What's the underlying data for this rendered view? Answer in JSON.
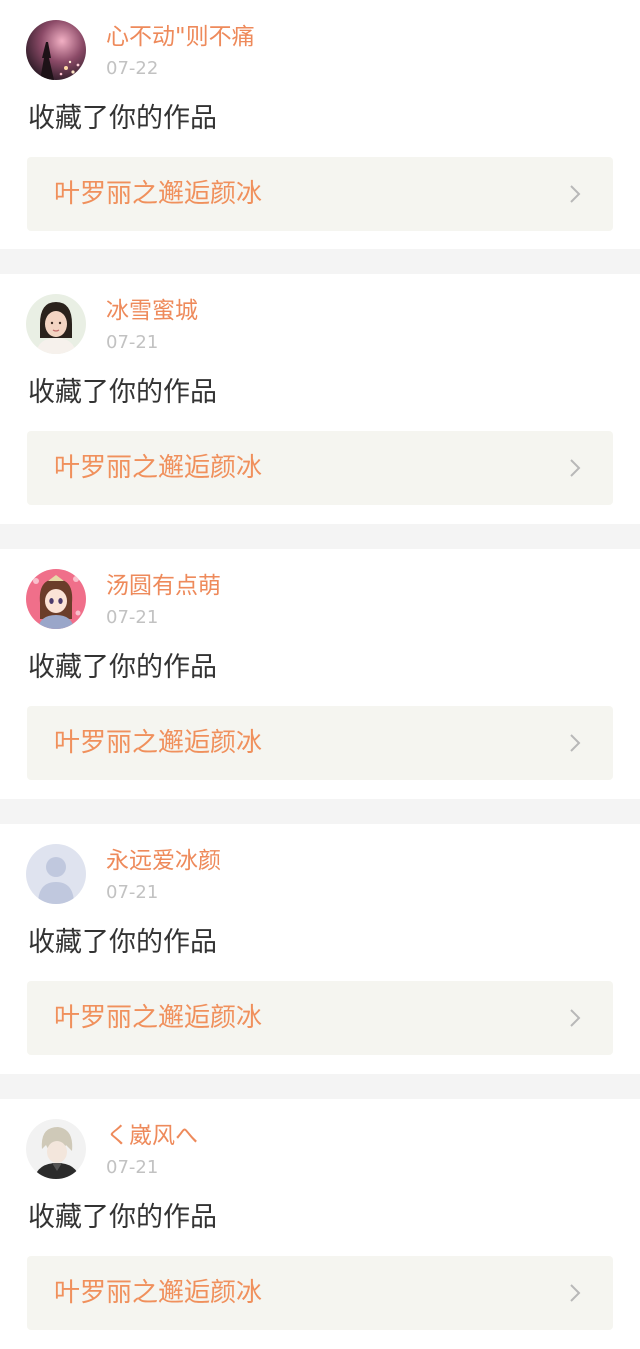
{
  "notifications": [
    {
      "username": "心不动\"则不痛",
      "date": "07-22",
      "action": "收藏了你的作品",
      "work_title": "叶罗丽之邂逅颜冰",
      "avatar_icon": "eiffel-tower-night-avatar"
    },
    {
      "username": "冰雪蜜城",
      "date": "07-21",
      "action": "收藏了你的作品",
      "work_title": "叶罗丽之邂逅颜冰",
      "avatar_icon": "woman-portrait-avatar"
    },
    {
      "username": "汤圆有点萌",
      "date": "07-21",
      "action": "收藏了你的作品",
      "work_title": "叶罗丽之邂逅颜冰",
      "avatar_icon": "anime-girl-avatar"
    },
    {
      "username": "永远爱冰颜",
      "date": "07-21",
      "action": "收藏了你的作品",
      "work_title": "叶罗丽之邂逅颜冰",
      "avatar_icon": "default-user-avatar"
    },
    {
      "username": "く崴风へ",
      "date": "07-21",
      "action": "收藏了你的作品",
      "work_title": "叶罗丽之邂逅颜冰",
      "avatar_icon": "anime-boy-avatar"
    }
  ],
  "colors": {
    "username": "#ee8a5b",
    "work_title": "#f0905c",
    "date": "#c2c2c2",
    "action_text": "#333333",
    "work_link_bg": "#f5f5f0",
    "separator": "#f4f4f4"
  }
}
